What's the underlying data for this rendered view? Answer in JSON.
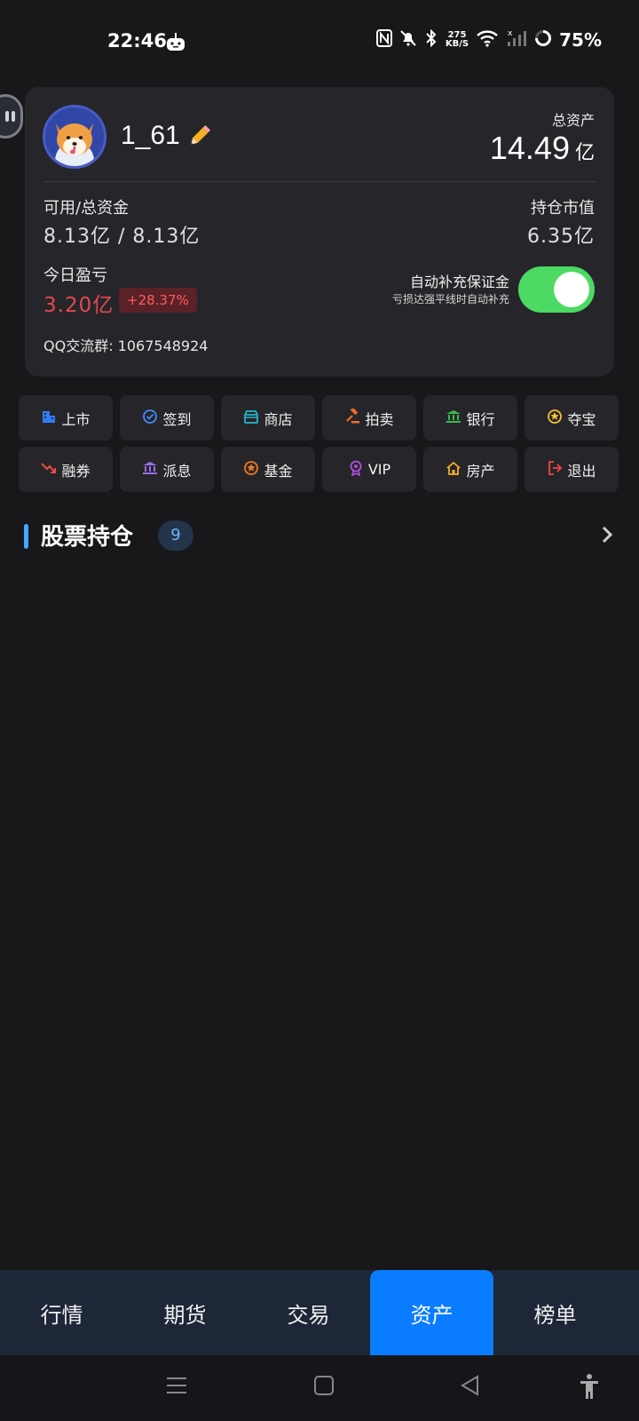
{
  "status_bar": {
    "time": "22:46",
    "net_speed_value": "275",
    "net_speed_unit": "KB/S",
    "battery": "75%",
    "icons": [
      "android-robot-icon",
      "nfc-icon",
      "bell-muted-icon",
      "bluetooth-icon",
      "wifi-icon",
      "cell-signal-icon",
      "battery-ring-icon"
    ]
  },
  "profile": {
    "username": "1_61",
    "total_assets_label": "总资产",
    "total_assets_value": "14.49",
    "total_assets_unit": "亿",
    "available_label": "可用/总资金",
    "available_value": "8.13亿 / 8.13亿",
    "market_value_label": "持仓市值",
    "market_value": "6.35亿",
    "today_pnl_label": "今日盈亏",
    "today_pnl_value": "3.20亿",
    "today_pnl_pct": "+28.37%",
    "auto_margin_title": "自动补充保证金",
    "auto_margin_sub": "亏损达强平线时自动补充",
    "auto_margin_on": true,
    "qq_group": "QQ交流群: 1067548924"
  },
  "features": [
    {
      "label": "上市",
      "icon": "building-icon",
      "color": "#2f7df6"
    },
    {
      "label": "签到",
      "icon": "check-circle-icon",
      "color": "#3f8cff"
    },
    {
      "label": "商店",
      "icon": "store-icon",
      "color": "#26b5c9"
    },
    {
      "label": "拍卖",
      "icon": "gavel-icon",
      "color": "#f06a2a"
    },
    {
      "label": "银行",
      "icon": "bank-icon",
      "color": "#3fb950"
    },
    {
      "label": "夺宝",
      "icon": "treasure-icon",
      "color": "#f2c230"
    },
    {
      "label": "融券",
      "icon": "trend-down-icon",
      "color": "#f04848"
    },
    {
      "label": "派息",
      "icon": "bank-icon",
      "color": "#9a6cf0"
    },
    {
      "label": "基金",
      "icon": "fund-icon",
      "color": "#f07a22"
    },
    {
      "label": "VIP",
      "icon": "vip-badge-icon",
      "color": "#b04ee0"
    },
    {
      "label": "房产",
      "icon": "house-icon",
      "color": "#f2b12a"
    },
    {
      "label": "退出",
      "icon": "logout-icon",
      "color": "#f04848"
    }
  ],
  "holdings": {
    "title": "股票持仓",
    "count": "9"
  },
  "tabs": [
    {
      "label": "行情",
      "active": false
    },
    {
      "label": "期货",
      "active": false
    },
    {
      "label": "交易",
      "active": false
    },
    {
      "label": "资产",
      "active": true
    },
    {
      "label": "榜单",
      "active": false
    }
  ],
  "system_nav": [
    "menu-icon",
    "home-square-icon",
    "back-triangle-icon",
    "accessibility-icon"
  ]
}
